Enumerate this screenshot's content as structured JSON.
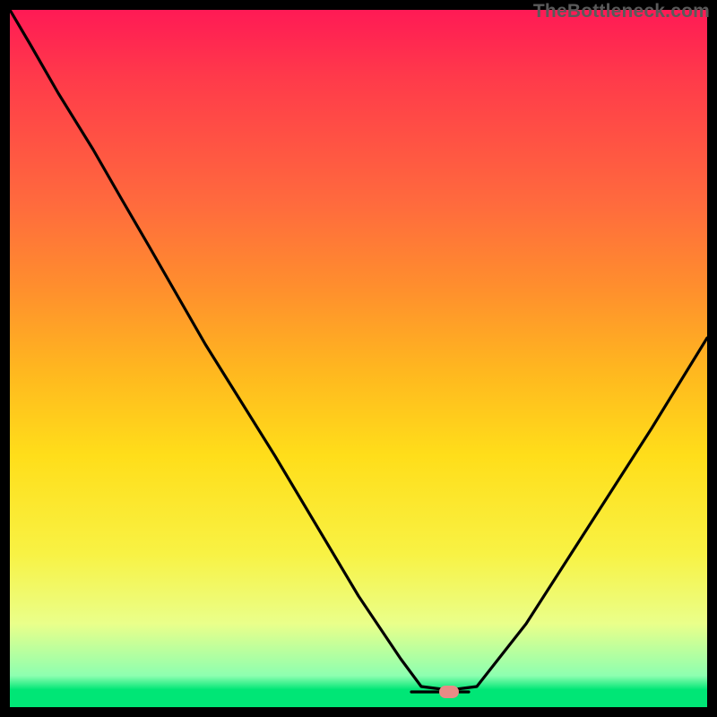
{
  "watermark": "TheBottleneck.com",
  "marker": {
    "x_pct": 63.0,
    "y_pct": 97.8,
    "color": "#e88b86"
  },
  "chart_data": {
    "type": "line",
    "title": "",
    "xlabel": "",
    "ylabel": "",
    "xlim": [
      0,
      100
    ],
    "ylim": [
      0,
      100
    ],
    "gradient_stops": [
      {
        "pos": 0.0,
        "color": "#ff1a55"
      },
      {
        "pos": 0.1,
        "color": "#ff3b4a"
      },
      {
        "pos": 0.28,
        "color": "#ff6b3d"
      },
      {
        "pos": 0.4,
        "color": "#ff8f2d"
      },
      {
        "pos": 0.52,
        "color": "#ffb81f"
      },
      {
        "pos": 0.64,
        "color": "#ffde1a"
      },
      {
        "pos": 0.78,
        "color": "#f8f244"
      },
      {
        "pos": 0.88,
        "color": "#eaff8a"
      },
      {
        "pos": 0.955,
        "color": "#8dffb0"
      },
      {
        "pos": 0.975,
        "color": "#00e676"
      },
      {
        "pos": 1.0,
        "color": "#00e676"
      }
    ],
    "series": [
      {
        "name": "bottleneck-curve",
        "x": [
          0.0,
          3.0,
          7.0,
          12.0,
          16.0,
          20.0,
          28.0,
          38.0,
          50.0,
          56.0,
          59.0,
          63.0,
          67.0,
          74.0,
          83.0,
          92.0,
          100.0
        ],
        "y": [
          100.0,
          95.0,
          88.0,
          80.0,
          73.0,
          66.0,
          52.0,
          36.0,
          16.0,
          7.0,
          3.0,
          2.5,
          3.0,
          12.0,
          26.0,
          40.0,
          53.0
        ]
      }
    ],
    "optimum_marker": {
      "x": 63.0,
      "y": 2.2
    }
  }
}
